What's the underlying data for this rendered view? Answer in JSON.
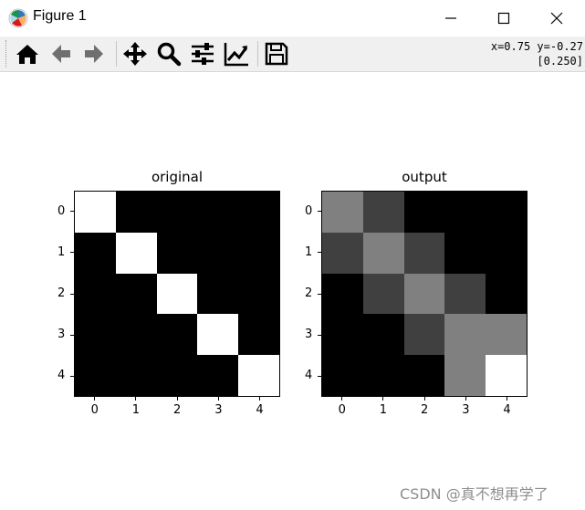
{
  "window": {
    "title": "Figure 1",
    "controls": {
      "minimize_icon": "minimize-icon",
      "maximize_icon": "maximize-icon",
      "close_icon": "close-icon"
    }
  },
  "toolbar": {
    "buttons": [
      {
        "name": "home",
        "icon": "home-icon"
      },
      {
        "name": "back",
        "icon": "arrow-left-icon"
      },
      {
        "name": "forward",
        "icon": "arrow-right-icon"
      },
      {
        "name": "pan",
        "icon": "move-icon"
      },
      {
        "name": "zoom",
        "icon": "magnifier-icon"
      },
      {
        "name": "configure-subplots",
        "icon": "sliders-icon"
      },
      {
        "name": "edit-axis",
        "icon": "line-chart-icon"
      },
      {
        "name": "save",
        "icon": "floppy-disk-icon"
      }
    ],
    "coords_line1": "x=0.75 y=-0.27",
    "coords_line2": "[0.250]"
  },
  "chart_data": [
    {
      "type": "heatmap",
      "title": "original",
      "colormap": "gray",
      "x_ticks": [
        "0",
        "1",
        "2",
        "3",
        "4"
      ],
      "y_ticks": [
        "0",
        "1",
        "2",
        "3",
        "4"
      ],
      "matrix": [
        [
          1,
          0,
          0,
          0,
          0
        ],
        [
          0,
          1,
          0,
          0,
          0
        ],
        [
          0,
          0,
          1,
          0,
          0
        ],
        [
          0,
          0,
          0,
          1,
          0
        ],
        [
          0,
          0,
          0,
          0,
          1
        ]
      ]
    },
    {
      "type": "heatmap",
      "title": "output",
      "colormap": "gray",
      "x_ticks": [
        "0",
        "1",
        "2",
        "3",
        "4"
      ],
      "y_ticks": [
        "0",
        "1",
        "2",
        "3",
        "4"
      ],
      "matrix": [
        [
          0.5,
          0.25,
          0,
          0,
          0
        ],
        [
          0.25,
          0.5,
          0.25,
          0,
          0
        ],
        [
          0,
          0.25,
          0.5,
          0.25,
          0
        ],
        [
          0,
          0,
          0.25,
          0.5,
          0.5
        ],
        [
          0,
          0,
          0,
          0.5,
          1
        ]
      ]
    }
  ],
  "watermark": "CSDN @真不想再学了"
}
